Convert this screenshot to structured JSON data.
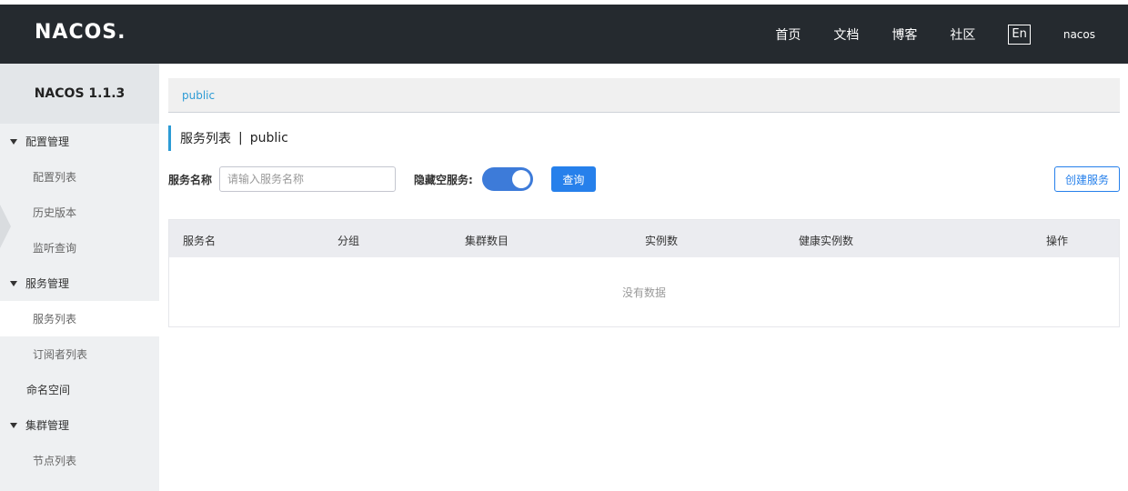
{
  "header": {
    "logo": "NACOS.",
    "nav": [
      {
        "label": "首页"
      },
      {
        "label": "文档"
      },
      {
        "label": "博客"
      },
      {
        "label": "社区"
      }
    ],
    "lang": "En",
    "user": "nacos"
  },
  "sidebar": {
    "version": "NACOS 1.1.3",
    "config_group": "配置管理",
    "config_items": [
      "配置列表",
      "历史版本",
      "监听查询"
    ],
    "service_group": "服务管理",
    "service_items": [
      "服务列表",
      "订阅者列表"
    ],
    "namespace": "命名空间",
    "cluster_group": "集群管理",
    "cluster_items": [
      "节点列表"
    ],
    "active_item": "服务列表"
  },
  "breadcrumb": {
    "namespace": "public"
  },
  "page": {
    "title": "服务列表",
    "separator": "|",
    "namespace": "public"
  },
  "filter": {
    "name_label": "服务名称",
    "name_placeholder": "请输入服务名称",
    "name_value": "",
    "hide_empty_label": "隐藏空服务:",
    "hide_empty_on": true,
    "query_label": "查询",
    "create_label": "创建服务"
  },
  "table": {
    "columns": [
      "服务名",
      "分组",
      "集群数目",
      "实例数",
      "健康实例数",
      "操作"
    ],
    "rows": [],
    "empty_text": "没有数据"
  },
  "colors": {
    "header_bg": "#252a2f",
    "accent": "#2680eb",
    "link": "#2c9bd5",
    "sidebar_bg": "#eef0f2"
  }
}
